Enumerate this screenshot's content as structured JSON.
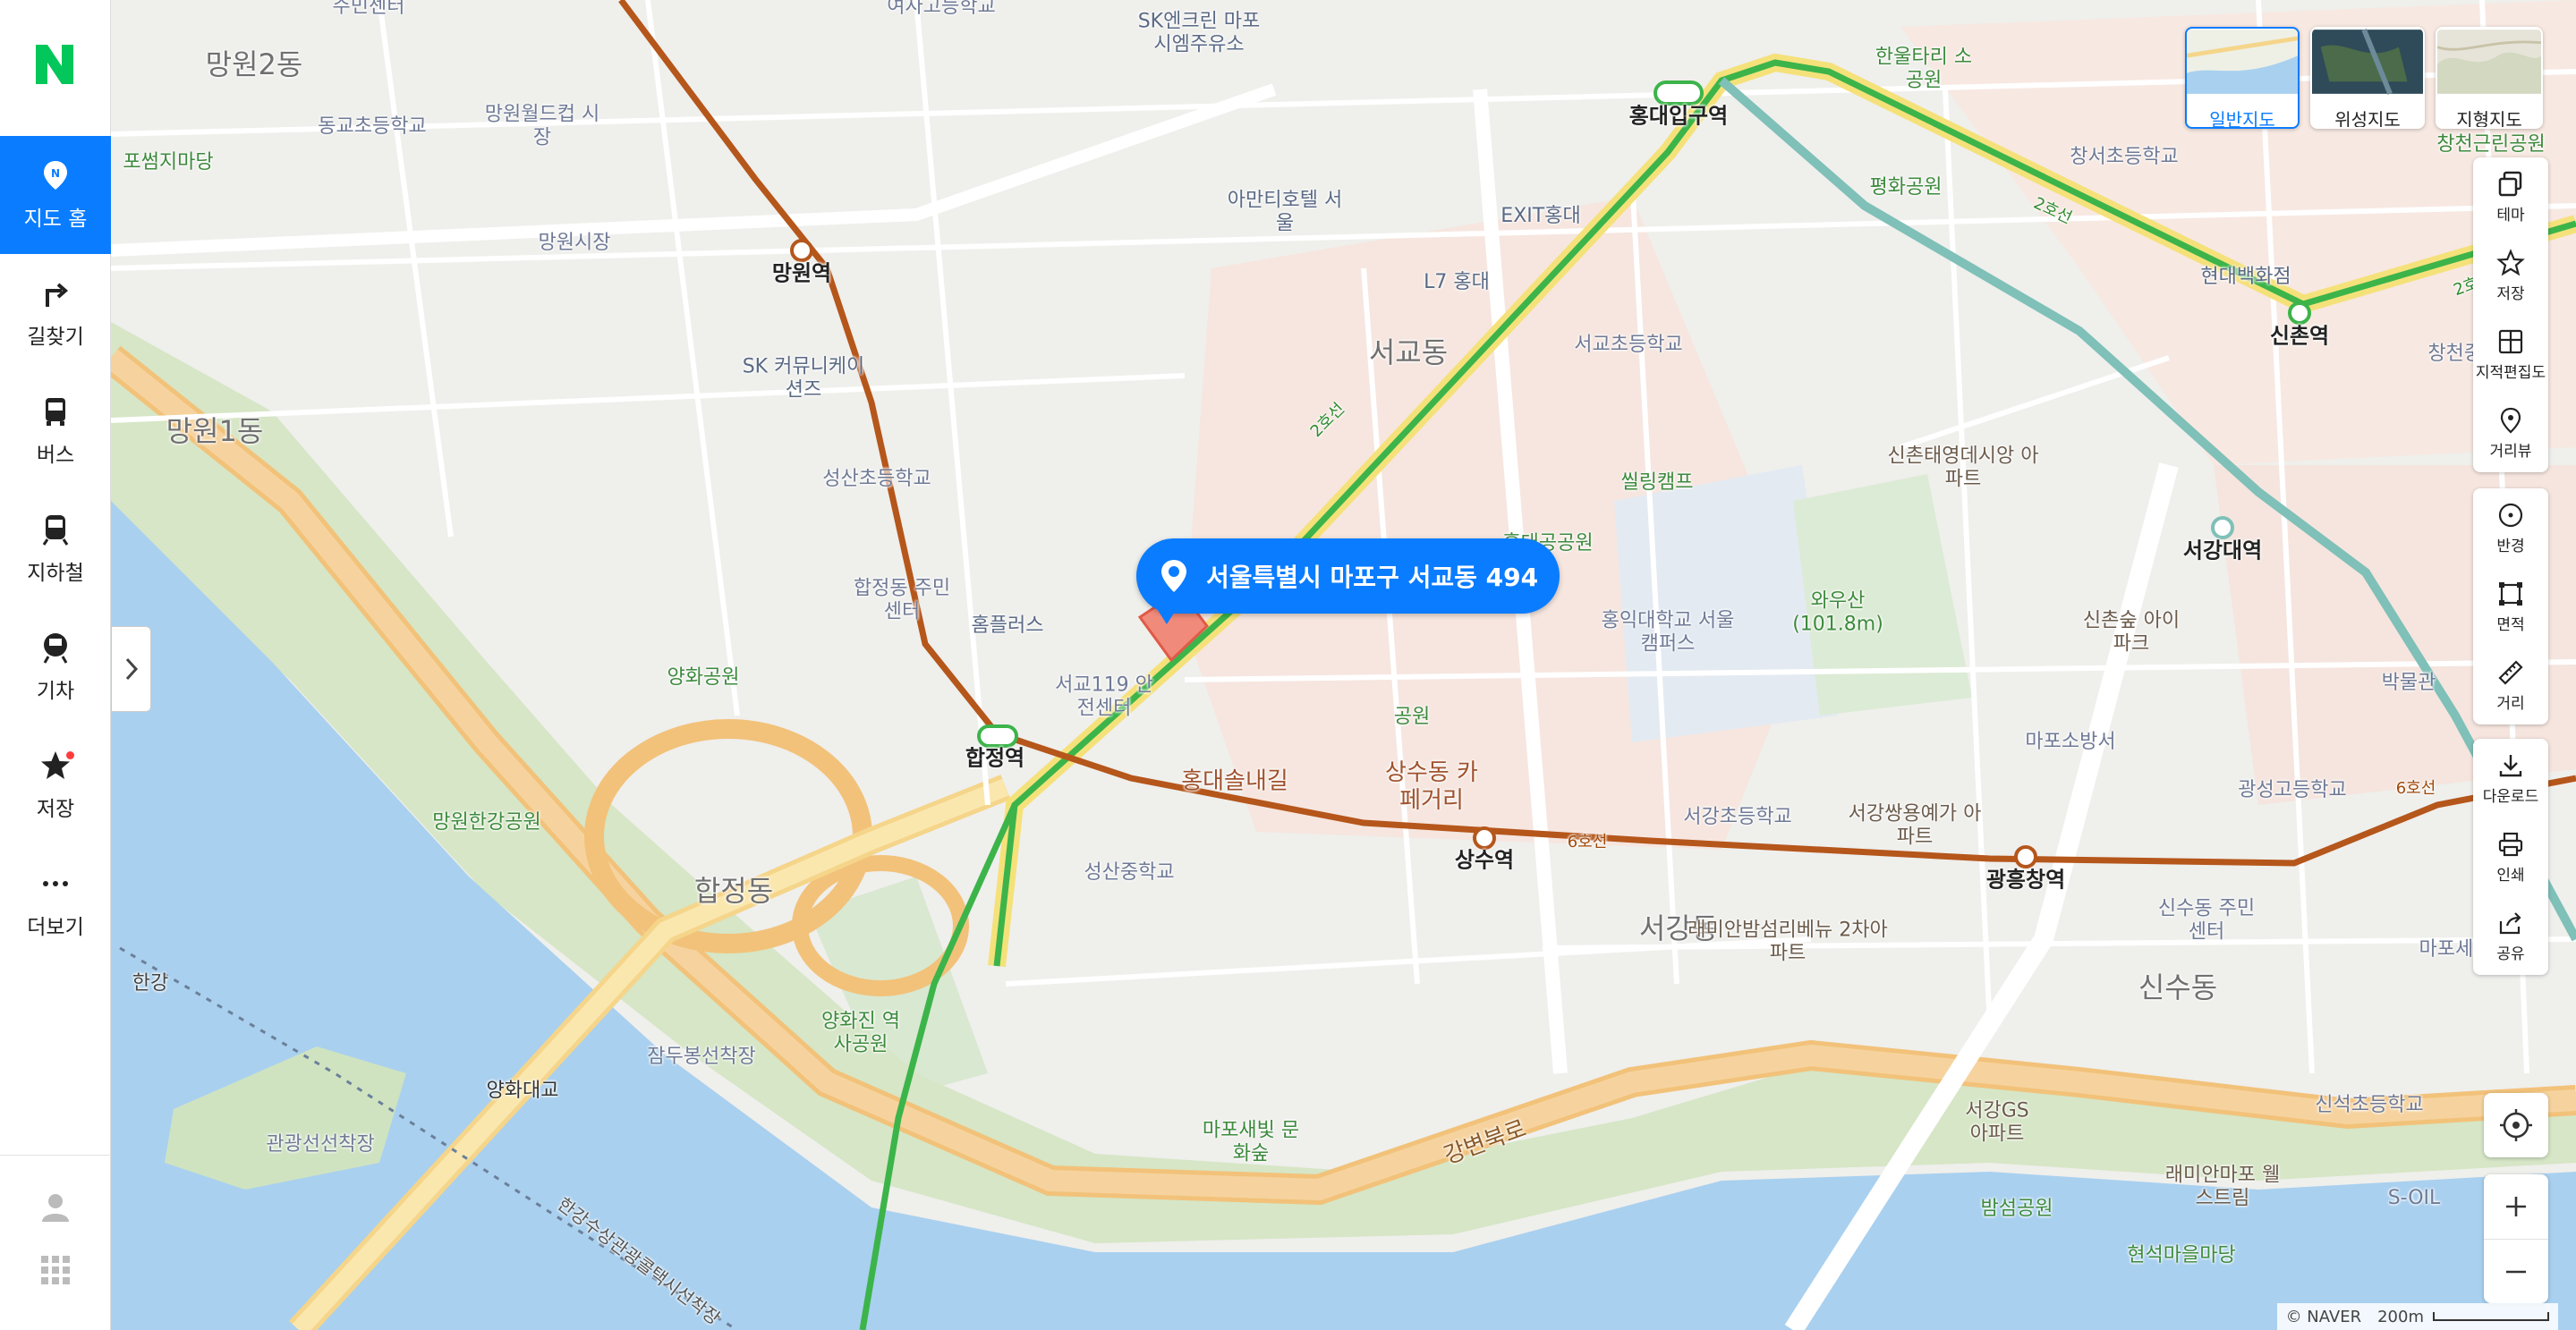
{
  "nav": {
    "items": [
      {
        "label": "지도 홈",
        "icon": "map-pin-icon",
        "active": true
      },
      {
        "label": "길찾기",
        "icon": "directions-icon"
      },
      {
        "label": "버스",
        "icon": "bus-icon"
      },
      {
        "label": "지하철",
        "icon": "subway-icon"
      },
      {
        "label": "기차",
        "icon": "train-icon"
      },
      {
        "label": "저장",
        "icon": "star-icon",
        "badge": true
      },
      {
        "label": "더보기",
        "icon": "more-icon"
      }
    ]
  },
  "callout": {
    "address": "서울특별시 마포구 서교동 494"
  },
  "map_types": [
    {
      "label": "일반지도",
      "selected": true
    },
    {
      "label": "위성지도"
    },
    {
      "label": "지형지도"
    }
  ],
  "tools": {
    "group1": [
      "테마",
      "저장",
      "지적편집도",
      "거리뷰"
    ],
    "group2": [
      "반경",
      "면적",
      "거리"
    ],
    "group3": [
      "다운로드",
      "인쇄",
      "공유"
    ]
  },
  "scale": {
    "attribution": "© NAVER",
    "distance": "200m"
  },
  "labels": {
    "dongs": [
      "망원2동",
      "망원1동",
      "서교동",
      "합정동",
      "서강동",
      "신수동"
    ],
    "stations": [
      "망원역",
      "홍대입구역",
      "합정역",
      "상수역",
      "광흥창역",
      "신촌역",
      "서강대역"
    ],
    "places": [
      "주민센터",
      "여자고등학교",
      "SK엔크린 마포시엠주유소",
      "한울타리 소공원",
      "창천근린공원",
      "동교초등학교",
      "망원월드컵 시장",
      "포썸지마당",
      "망원시장",
      "아만티호텔 서울",
      "EXIT홍대",
      "L7 홍대",
      "서교초등학교",
      "평화공원",
      "창서초등학교",
      "현대백화점",
      "창천중학교",
      "SK 커뮤니케이션즈",
      "성산초등학교",
      "신촌태영데시앙 아파트",
      "씰링캠프",
      "합정동 주민센터",
      "홈플러스",
      "양화공원",
      "서교119 안전센터",
      "와우산 (101.8m)",
      "홍익대학교 서울캠퍼스",
      "신촌숲 아이파크",
      "박물관",
      "공원",
      "마포소방서",
      "광성고등학교",
      "홍대솔내길",
      "상수동 카페거리",
      "서강초등학교",
      "서강쌍용예가 아파트",
      "망원한강공원",
      "성산중학교",
      "래미안밤섬리베뉴 2차아파트",
      "신수동 주민센터",
      "마포세무",
      "한강",
      "잠두봉선착장",
      "양화진 역사공원",
      "양화대교",
      "관광선선착장",
      "마포새빛 문화숲",
      "강변북로",
      "서강GS 아파트",
      "래미안마포 웰스트림",
      "밤섬공원",
      "현석마을마당",
      "신석초등학교",
      "S-OIL",
      "홍대공공원",
      "한강수상관광콜택시선착장",
      "6호선",
      "2호선"
    ]
  }
}
